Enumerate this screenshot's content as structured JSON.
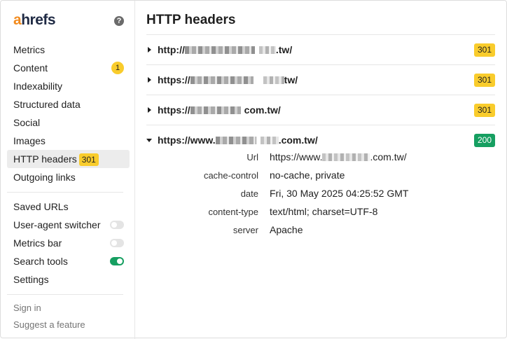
{
  "app": {
    "logo_a": "a",
    "logo_rest": "hrefs",
    "help_glyph": "?"
  },
  "sidebar": {
    "items": [
      {
        "label": "Metrics"
      },
      {
        "label": "Content",
        "count": "1"
      },
      {
        "label": "Indexability"
      },
      {
        "label": "Structured data"
      },
      {
        "label": "Social"
      },
      {
        "label": "Images"
      },
      {
        "label": "HTTP headers",
        "badge": "301"
      },
      {
        "label": "Outgoing links"
      }
    ],
    "tools": [
      {
        "label": "Saved URLs"
      },
      {
        "label": "User-agent switcher",
        "toggle": false
      },
      {
        "label": "Metrics bar",
        "toggle": false
      },
      {
        "label": "Search tools",
        "toggle": true
      },
      {
        "label": "Settings"
      }
    ],
    "footer": {
      "sign_in": "Sign in",
      "suggest": "Suggest a feature"
    }
  },
  "main": {
    "title": "HTTP headers",
    "redirects": [
      {
        "prefix": "http://",
        "suffix": ".tw/",
        "status": "301"
      },
      {
        "prefix": "https://",
        "suffix": "tw/",
        "status": "301"
      },
      {
        "prefix": "https://",
        "suffix": "com.tw/",
        "status": "301"
      },
      {
        "prefix": "https://www.",
        "suffix": ".com.tw/",
        "status": "200"
      }
    ],
    "headers": [
      {
        "key": "Url",
        "prefix": "https://www.",
        "suffix": ".com.tw/"
      },
      {
        "key": "cache-control",
        "value": "no-cache, private"
      },
      {
        "key": "date",
        "value": "Fri, 30 May 2025 04:25:52 GMT"
      },
      {
        "key": "content-type",
        "value": "text/html; charset=UTF-8"
      },
      {
        "key": "server",
        "value": "Apache"
      }
    ]
  },
  "colors": {
    "status_redirect": "#f9cc2c",
    "status_ok": "#169f61",
    "toggle_on": "#169f61",
    "brand_orange": "#f28b1e"
  }
}
